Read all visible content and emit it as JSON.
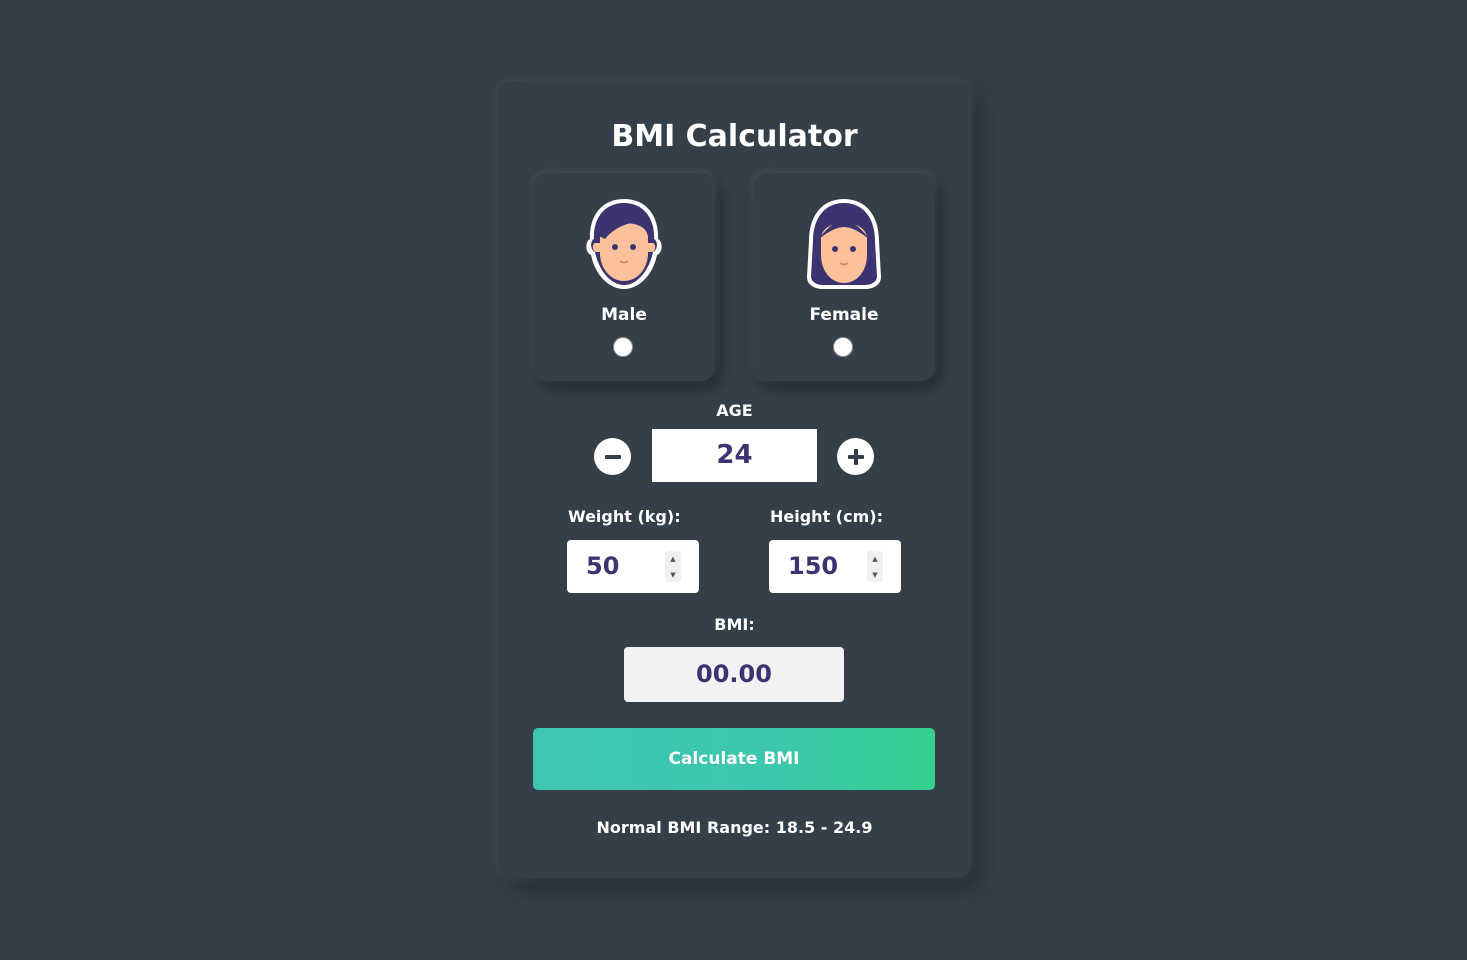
{
  "title": "BMI Calculator",
  "gender": {
    "male_label": "Male",
    "female_label": "Female",
    "male_icon": "male-avatar-icon",
    "female_icon": "female-avatar-icon",
    "selected": null
  },
  "age": {
    "label": "AGE",
    "value": "24",
    "minus_icon": "minus-icon",
    "plus_icon": "plus-icon"
  },
  "weight": {
    "label": "Weight (kg):",
    "value": "50"
  },
  "height": {
    "label": "Height (cm):",
    "value": "150"
  },
  "bmi": {
    "label": "BMI:",
    "value": "00.00"
  },
  "calculate_button": "Calculate BMI",
  "normal_range": "Normal BMI Range: 18.5 - 24.9",
  "colors": {
    "background": "#343f4a",
    "accent_gradient_start": "#3ec6b2",
    "accent_gradient_end": "#34d08f",
    "value_text": "#3c3470",
    "avatar_hair": "#3c3470",
    "avatar_skin": "#fcc19a"
  }
}
